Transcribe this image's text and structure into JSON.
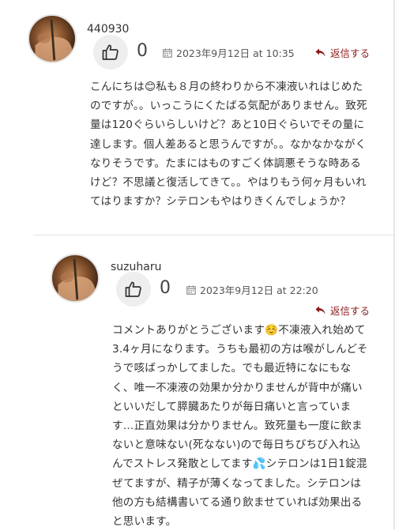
{
  "comments": [
    {
      "author": "440930",
      "likes": "0",
      "date": "2023年9月12日 at 10:35",
      "reply_label": "返信する",
      "text": "こんにちは😊私も８月の終わりから不凍液いれはじめたのですが。。いっこうにくたばる気配がありません。致死量は120ぐらいらしいけど？あと10日ぐらいでその量に達します。個人差あると思うんですが。。なかなかながくなりそうです。たまにはものすごく体調悪そうな時あるけど？不思議と復活してきて。。やはりもう何ヶ月もいれてはりますか？シテロンもやはりきくんでしょうか？"
    },
    {
      "author": "suzuharu",
      "likes": "0",
      "date": "2023年9月12日 at 22:20",
      "reply_label": "返信する",
      "text": "コメントありがとうございます☺️不凍液入れ始めて3.4ヶ月になります。うちも最初の方は喉がしんどそうで咳ばっかしてました。でも最近特になにもなく、唯一不凍液の効果か分かりませんが背中が痛いといいだして膵臓あたりが毎日痛いと言っています…正直効果は分かりません。致死量も一度に飲まないと意味ない(死なない)ので毎日ちびちび入れ込んでストレス発散としてます💦シテロンは1日1錠混ぜてますが、精子が薄くなってました。シテロンは他の方も結構書いてる通り飲ませていれば効果出ると思います。"
    }
  ],
  "colors": {
    "reply": "#8b1a1a",
    "like_bg": "#eeeeee",
    "separator": "#e4e4e4"
  },
  "icons": {
    "like": "thumbs-up-icon",
    "date": "calendar-icon",
    "reply": "reply-arrow-icon"
  }
}
